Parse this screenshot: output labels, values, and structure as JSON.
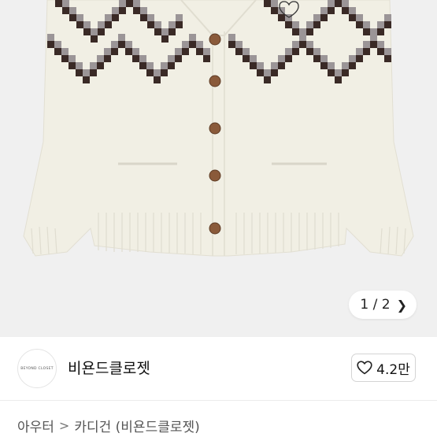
{
  "product_image": {
    "alt": "cream knit cardigan",
    "colors": {
      "background": "#f0f0f0",
      "knit": "#f1efe4",
      "pattern_dark": "#3a2a26",
      "pattern_grey": "#9b9597",
      "button": "#8a5a3a"
    }
  },
  "pager": {
    "current": 1,
    "total": 2,
    "text": "1 / 2",
    "next_icon": "chevron-right-icon"
  },
  "store": {
    "avatar_text": "BEYOND CLOSET",
    "name": "비욘드클로젯",
    "like_icon": "heart-outline-icon",
    "like_count": "4.2만"
  },
  "breadcrumb": {
    "items": [
      "아우터",
      "카디건 (비욘드클로젯)"
    ],
    "separator": ">"
  }
}
